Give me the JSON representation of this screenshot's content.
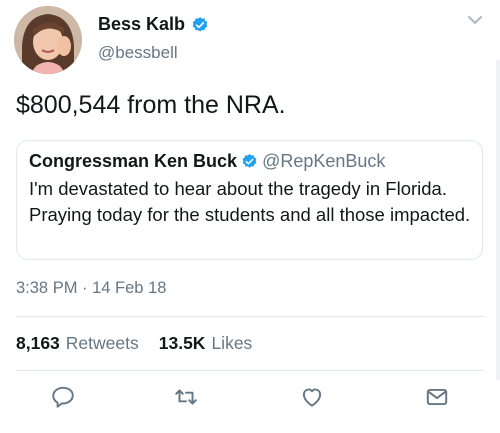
{
  "author": {
    "display_name": "Bess Kalb",
    "handle": "@bessbell",
    "avatar_icon": "profile-photo"
  },
  "tweet": {
    "text": "$800,544 from the NRA."
  },
  "quoted_tweet": {
    "display_name": "Congressman Ken Buck",
    "handle": "@RepKenBuck",
    "text": "I'm devastated to hear about the tragedy in Florida. Praying today for the students and all those impacted."
  },
  "meta": {
    "timestamp": "3:38 PM · 14 Feb 18"
  },
  "stats": {
    "retweets_count": "8,163",
    "retweets_label": "Retweets",
    "likes_count": "13.5K",
    "likes_label": "Likes"
  },
  "actions": [
    "reply-icon",
    "retweet-icon",
    "like-icon",
    "message-icon"
  ],
  "colors": {
    "verified": "#1da1f2",
    "secondary_text": "#657786",
    "primary_text": "#14171a",
    "border": "#e1e8ed"
  }
}
